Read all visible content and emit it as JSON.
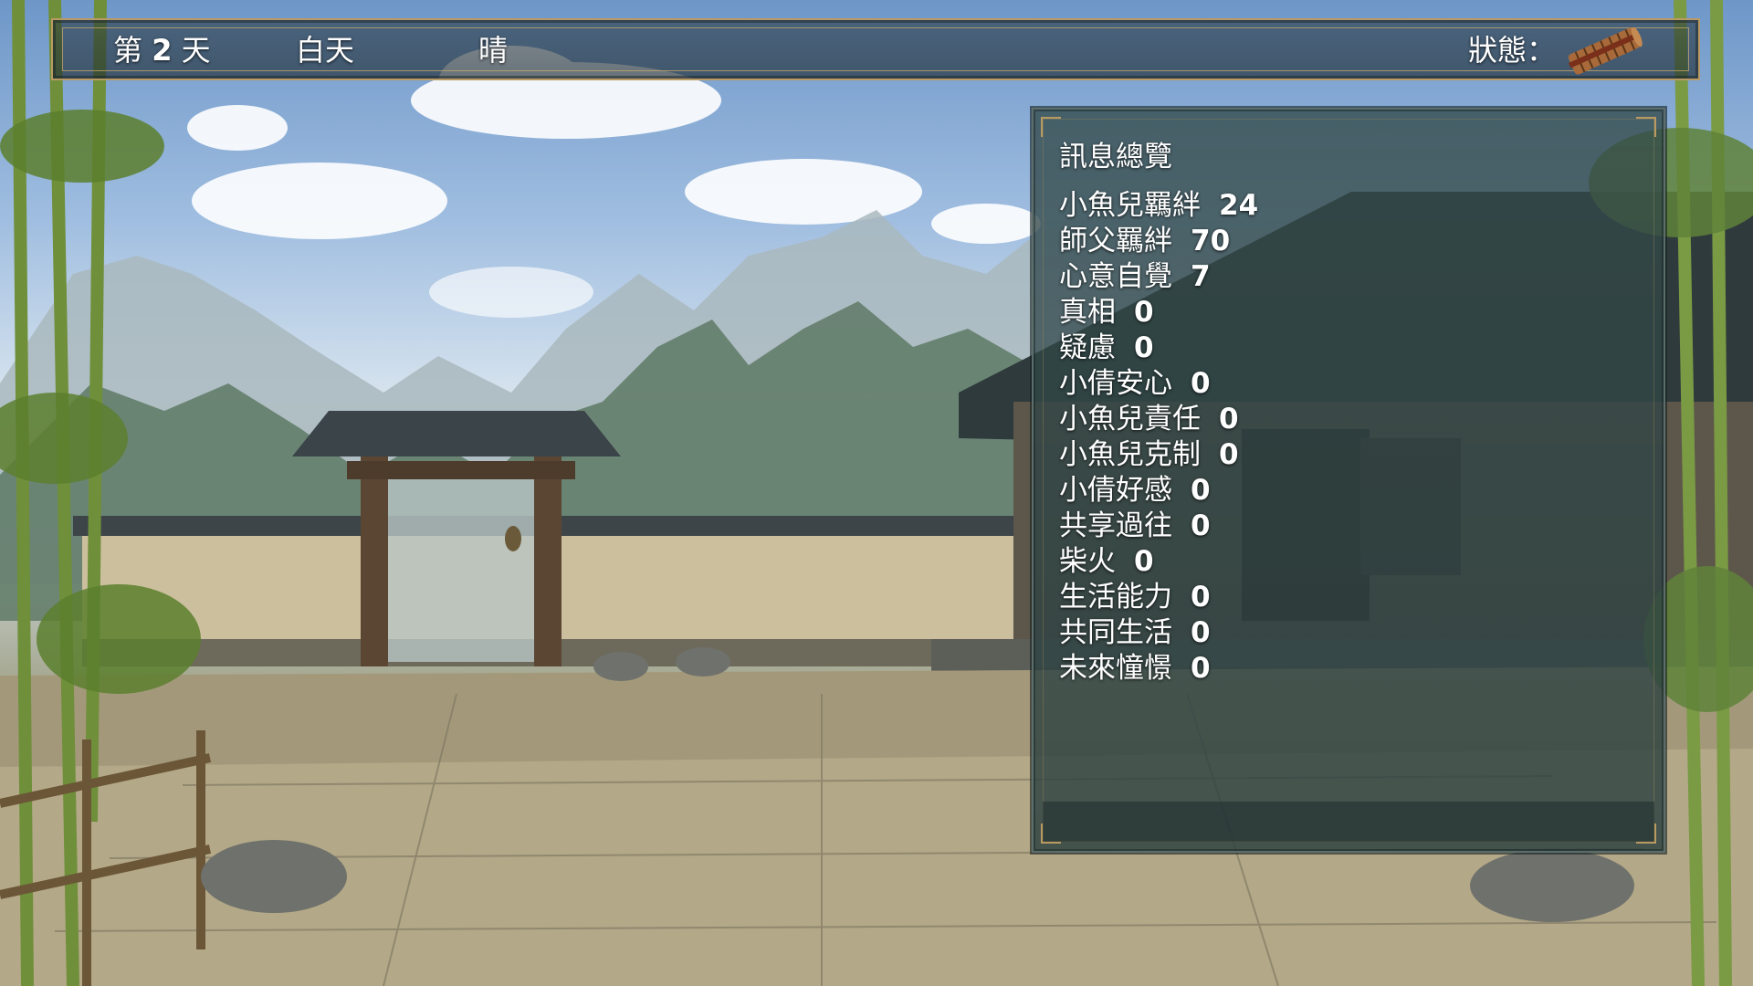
{
  "hud": {
    "day_prefix": "第",
    "day_number": "2",
    "day_suffix": "天",
    "period": "白天",
    "weather": "晴",
    "status_label": "狀態：",
    "status_icon": "bamboo-scroll-icon"
  },
  "overview": {
    "title": "訊息總覽",
    "stats": [
      {
        "label": "小魚兒羈絆",
        "value": "24"
      },
      {
        "label": "師父羈絆",
        "value": "70"
      },
      {
        "label": "心意自覺",
        "value": "7"
      },
      {
        "label": "真相",
        "value": "0"
      },
      {
        "label": "疑慮",
        "value": "0"
      },
      {
        "label": "小倩安心",
        "value": "0"
      },
      {
        "label": "小魚兒責任",
        "value": "0"
      },
      {
        "label": "小魚兒克制",
        "value": "0"
      },
      {
        "label": "小倩好感",
        "value": "0"
      },
      {
        "label": "共享過往",
        "value": "0"
      },
      {
        "label": "柴火",
        "value": "0"
      },
      {
        "label": "生活能力",
        "value": "0"
      },
      {
        "label": "共同生活",
        "value": "0"
      },
      {
        "label": "未來憧憬",
        "value": "0"
      }
    ]
  },
  "colors": {
    "frame_gold": "#b99a62",
    "panel_bg": "#344a4a",
    "text": "#ffffff"
  }
}
